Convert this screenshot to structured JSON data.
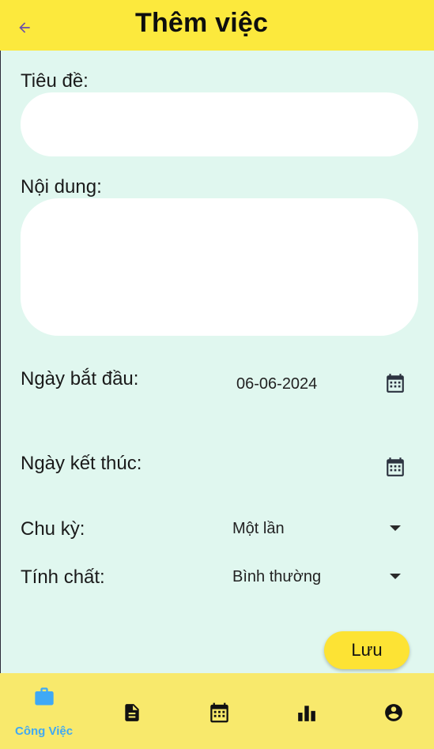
{
  "appbar": {
    "title": "Thêm việc",
    "back_icon": "arrow-left-icon"
  },
  "form": {
    "title_label": "Tiêu đề:",
    "title_value": "",
    "content_label": "Nội dung:",
    "content_value": "",
    "start_label": "Ngày bắt đầu:",
    "start_value": "06-06-2024",
    "end_label": "Ngày kết thúc:",
    "end_value": "",
    "cycle_label": "Chu kỳ:",
    "cycle_value": "Một lần",
    "nature_label": "Tính chất:",
    "nature_value": "Bình thường",
    "save_label": "Lưu"
  },
  "bottom_nav": {
    "items": [
      {
        "icon": "briefcase-icon",
        "label": "Công Việc",
        "active": true
      },
      {
        "icon": "document-icon",
        "label": ""
      },
      {
        "icon": "calendar-icon",
        "label": ""
      },
      {
        "icon": "bar-chart-icon",
        "label": ""
      },
      {
        "icon": "account-icon",
        "label": ""
      }
    ]
  },
  "colors": {
    "appbar": "#fce93d",
    "background": "#e0f7ef",
    "accent_active": "#3fa9f5",
    "nav_background": "#f8e96c",
    "save_button": "#fde334"
  }
}
